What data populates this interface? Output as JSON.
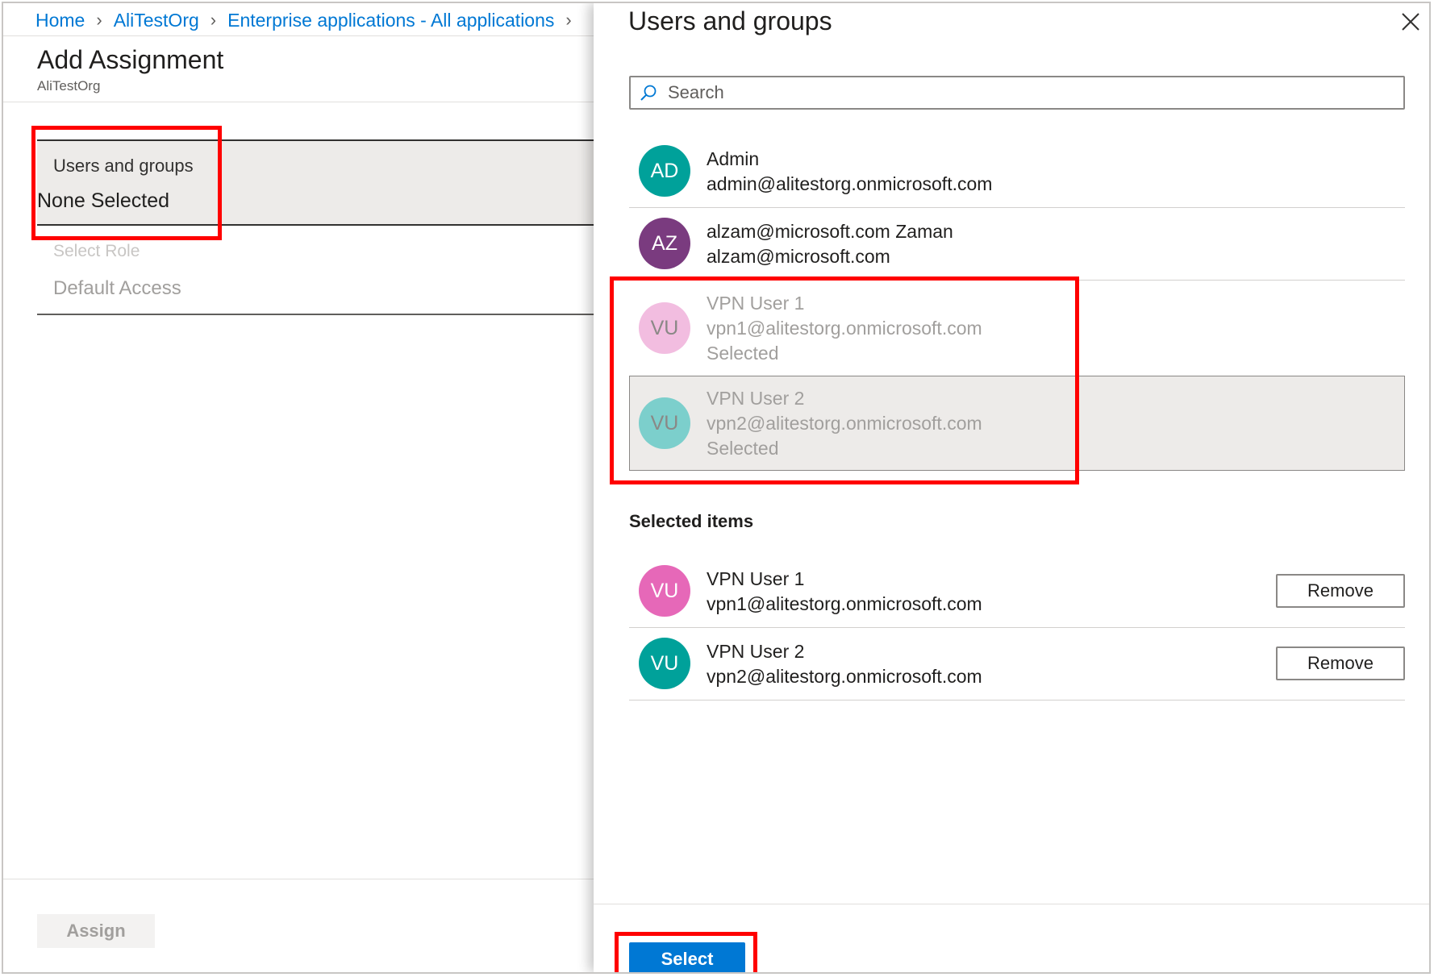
{
  "breadcrumb": {
    "items": [
      "Home",
      "AliTestOrg",
      "Enterprise applications - All applications"
    ]
  },
  "assignment": {
    "title": "Add Assignment",
    "subtitle": "AliTestOrg",
    "users_label": "Users and groups",
    "users_value": "None Selected",
    "role_label": "Select Role",
    "role_value": "Default Access",
    "assign_label": "Assign"
  },
  "panel": {
    "title": "Users and groups",
    "search_placeholder": "Search",
    "users": [
      {
        "initials": "AD",
        "name": "Admin",
        "email": "admin@alitestorg.onmicrosoft.com",
        "status": "",
        "color": "#00a19a"
      },
      {
        "initials": "AZ",
        "name": "alzam@microsoft.com Zaman",
        "email": "alzam@microsoft.com",
        "status": "",
        "color": "#7a3b7f"
      },
      {
        "initials": "VU",
        "name": "VPN User 1",
        "email": "vpn1@alitestorg.onmicrosoft.com",
        "status": "Selected",
        "color": "#f2bde0"
      },
      {
        "initials": "VU",
        "name": "VPN User 2",
        "email": "vpn2@alitestorg.onmicrosoft.com",
        "status": "Selected",
        "color": "#7ccfcc"
      }
    ],
    "selected_header": "Selected items",
    "selected": [
      {
        "initials": "VU",
        "name": "VPN User 1",
        "email": "vpn1@alitestorg.onmicrosoft.com",
        "color": "#e668b8",
        "remove_label": "Remove"
      },
      {
        "initials": "VU",
        "name": "VPN User 2",
        "email": "vpn2@alitestorg.onmicrosoft.com",
        "color": "#00a19a",
        "remove_label": "Remove"
      }
    ],
    "select_label": "Select"
  },
  "colors": {
    "accent": "#0078d4",
    "annotation": "#ff0000"
  }
}
